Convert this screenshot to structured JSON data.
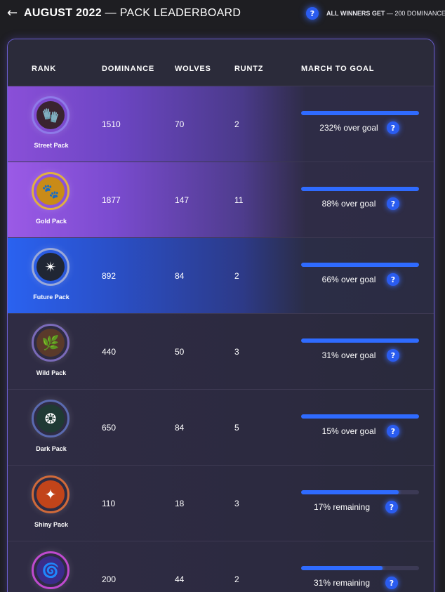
{
  "header": {
    "back_icon": "←",
    "month": "AUGUST 2022",
    "subtitle": "— PACK LEADERBOARD",
    "info_icon": "?",
    "winners_bold": "ALL WINNERS GET",
    "winners_rest": " — 200 DOMINANCE"
  },
  "table": {
    "columns": [
      "RANK",
      "DOMINANCE",
      "WOLVES",
      "RUNTZ",
      "MARCH TO GOAL"
    ],
    "rows": [
      {
        "name": "Street Pack",
        "dominance": "1510",
        "wolves": "70",
        "runtz": "2",
        "goal_text": "232% over goal",
        "progress": 1.0,
        "style": "hl-purple",
        "badge_color": "#3a2430",
        "badge_icon": "🧤",
        "ring": "#8e7ae8"
      },
      {
        "name": "Gold Pack",
        "dominance": "1877",
        "wolves": "147",
        "runtz": "11",
        "goal_text": "88% over goal",
        "progress": 1.0,
        "style": "hl-purple2",
        "badge_color": "#c98b18",
        "badge_icon": "🐾",
        "ring": "#e0b040"
      },
      {
        "name": "Future Pack",
        "dominance": "892",
        "wolves": "84",
        "runtz": "2",
        "goal_text": "66% over goal",
        "progress": 1.0,
        "style": "hl-blue",
        "badge_color": "#202634",
        "badge_icon": "✴",
        "ring": "#9aa8d8"
      },
      {
        "name": "Wild Pack",
        "dominance": "440",
        "wolves": "50",
        "runtz": "3",
        "goal_text": "31% over goal",
        "progress": 1.0,
        "style": "",
        "badge_color": "#5a3a2a",
        "badge_icon": "🌿",
        "ring": "#7a6ab8"
      },
      {
        "name": "Dark Pack",
        "dominance": "650",
        "wolves": "84",
        "runtz": "5",
        "goal_text": "15% over goal",
        "progress": 1.0,
        "style": "",
        "badge_color": "#1f3a34",
        "badge_icon": "❂",
        "ring": "#5a6ab0"
      },
      {
        "name": "Shiny Pack",
        "dominance": "110",
        "wolves": "18",
        "runtz": "3",
        "goal_text": "17% remaining",
        "progress": 0.83,
        "style": "",
        "badge_color": "#c2441a",
        "badge_icon": "✦",
        "ring": "#d06a3a"
      },
      {
        "name": "",
        "dominance": "200",
        "wolves": "44",
        "runtz": "2",
        "goal_text": "31% remaining",
        "progress": 0.69,
        "style": "",
        "badge_color": "#3a2c8a",
        "badge_icon": "🌀",
        "ring": "#c04ad0"
      }
    ]
  },
  "colors": {
    "accent": "#2f6bff",
    "background": "#1e1e22",
    "panel_border": "#6b5fd0"
  }
}
